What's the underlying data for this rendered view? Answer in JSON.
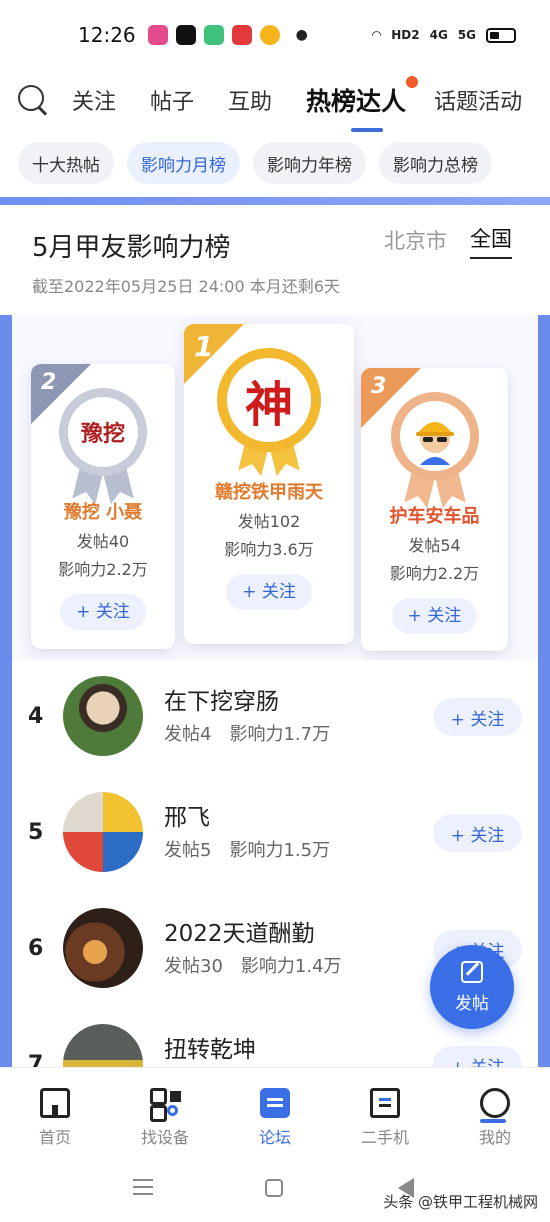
{
  "status_bar": {
    "time": "12:26",
    "network_labels": [
      "HD2",
      "4G",
      "5G"
    ]
  },
  "top_nav": {
    "tabs": [
      {
        "label": "关注"
      },
      {
        "label": "帖子"
      },
      {
        "label": "互助"
      },
      {
        "label": "热榜达人"
      },
      {
        "label": "话题活动"
      }
    ],
    "active_tab": "热榜达人"
  },
  "sub_tabs": {
    "chips": [
      {
        "label": "十大热帖"
      },
      {
        "label": "影响力月榜"
      },
      {
        "label": "影响力年榜"
      },
      {
        "label": "影响力总榜"
      }
    ],
    "active_chip": "影响力月榜"
  },
  "board": {
    "title": "5月甲友影响力榜",
    "scope_city": "北京市",
    "scope_nation": "全国",
    "subtitle": "截至2022年05月25日 24:00 本月还剩6天"
  },
  "podium": [
    {
      "rank": "2",
      "name": "豫挖 小聂",
      "badge_text": "豫挖",
      "posts": "发帖40",
      "influence": "影响力2.2万",
      "follow_label": "+ 关注"
    },
    {
      "rank": "1",
      "name": "赣挖铁甲雨天",
      "badge_text": "神",
      "posts": "发帖102",
      "influence": "影响力3.6万",
      "follow_label": "+ 关注"
    },
    {
      "rank": "3",
      "name": "护车安车品",
      "badge_text": "",
      "posts": "发帖54",
      "influence": "影响力2.2万",
      "follow_label": "+ 关注"
    }
  ],
  "list": [
    {
      "rank": "4",
      "name": "在下挖穿肠",
      "posts": "发帖4",
      "influence": "影响力1.7万",
      "follow_label": "+ 关注"
    },
    {
      "rank": "5",
      "name": "邢飞",
      "posts": "发帖5",
      "influence": "影响力1.5万",
      "follow_label": "+ 关注"
    },
    {
      "rank": "6",
      "name": "2022天道酬勤",
      "posts": "发帖30",
      "influence": "影响力1.4万",
      "follow_label": "+ 关注"
    },
    {
      "rank": "7",
      "name": "扭转乾坤",
      "posts": "",
      "influence": "",
      "follow_label": "+ 关注"
    }
  ],
  "fab": {
    "label": "发帖"
  },
  "bottom_nav": [
    {
      "label": "首页",
      "icon": "home-icon"
    },
    {
      "label": "找设备",
      "icon": "grid-search-icon"
    },
    {
      "label": "论坛",
      "icon": "forum-icon"
    },
    {
      "label": "二手机",
      "icon": "used-machine-icon"
    },
    {
      "label": "我的",
      "icon": "profile-icon"
    }
  ],
  "active_bottom": "论坛",
  "watermark": "头条 @铁甲工程机械网",
  "colors": {
    "accent": "#3a6ee6",
    "orange": "#e07a2c",
    "gold": "#f0b536"
  }
}
